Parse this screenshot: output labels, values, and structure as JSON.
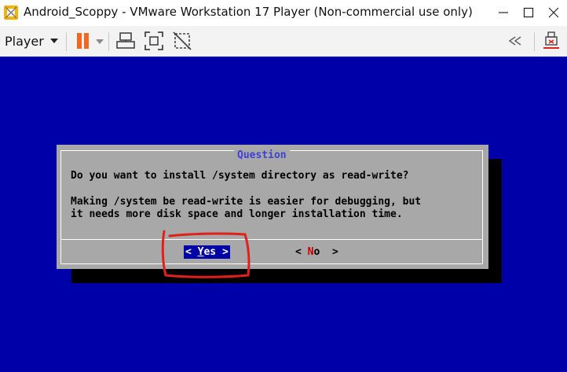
{
  "window": {
    "title": "Android_Scoppy - VMware Workstation 17 Player (Non-commercial use only)",
    "icon": "vmware-logo-icon",
    "controls": [
      "minimize-icon",
      "maximize-icon",
      "close-icon"
    ]
  },
  "toolbar": {
    "player_label": "Player",
    "tools": [
      "pause-icon",
      "dropdown-arrow-icon",
      "send-ctrl-alt-del-icon",
      "full-screen-icon",
      "unity-icon",
      "collapse-icon",
      "removable-devices-icon"
    ],
    "accent": "#f26722"
  },
  "dialog": {
    "title": "Question",
    "question": "Do you want to install /system directory as read-write?",
    "detail_lines": [
      "Making /system be read-write is easier for debugging, but",
      "it needs more disk space and longer installation time."
    ],
    "buttons": {
      "yes": {
        "left": "<",
        "hotkey": "Y",
        "rest": "es",
        "right": ">"
      },
      "no": {
        "left": "<",
        "hotkey": "N",
        "rest": "o",
        "right": ">"
      }
    }
  },
  "colors": {
    "vm_background": "#0000a8",
    "dialog_background": "#a8a8a8",
    "dialog_title": "#3f3fd8",
    "selected_button": "#0000a8",
    "annotation": "#e0201a"
  }
}
